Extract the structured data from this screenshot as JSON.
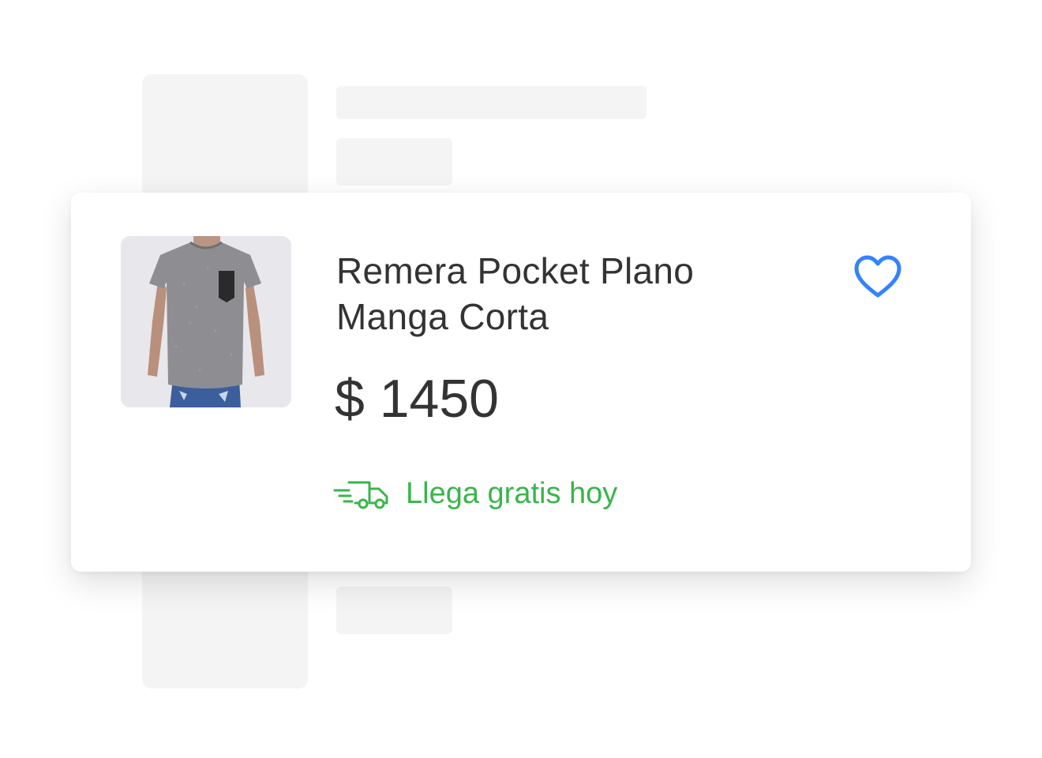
{
  "product": {
    "title_line1": "Remera Pocket Plano",
    "title_line2": "Manga Corta",
    "price": "$ 1450",
    "shipping_text": "Llega gratis hoy",
    "image_icon": "product-photo-tshirt",
    "favorite_icon": "heart-outline-icon",
    "shipping_icon": "fast-delivery-truck-icon"
  },
  "colors": {
    "shipping_green": "#39b54a",
    "favorite_blue": "#3483fa",
    "text": "#333333",
    "skeleton": "#f4f4f4"
  }
}
